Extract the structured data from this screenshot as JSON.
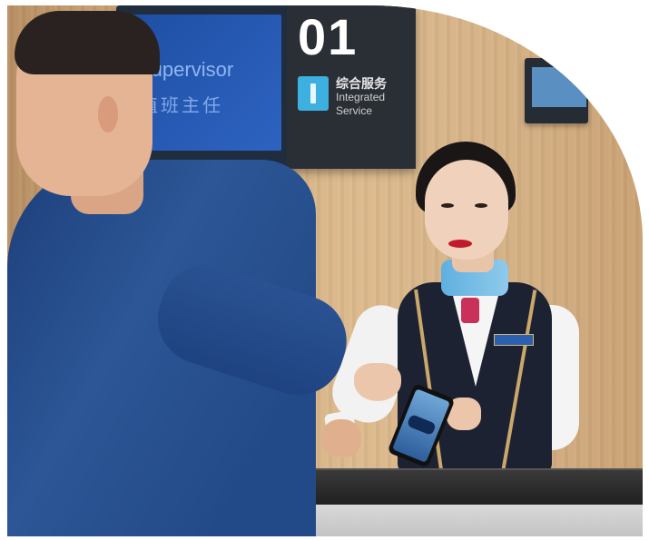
{
  "image": {
    "sign": {
      "counter_number": "01",
      "supervisor_en": "Supervisor",
      "supervisor_cn": "值班主任",
      "service_cn": "综合服务",
      "service_en_line1": "Integrated",
      "service_en_line2": "Service"
    },
    "icons": [
      "info-icon"
    ],
    "colors": {
      "wall": "#d1ac7e",
      "sign_blue": "#2d63c1",
      "uniform_vest": "#1d2233",
      "collar_blue": "#5fb0df",
      "suit_blue": "#2c5696"
    }
  }
}
